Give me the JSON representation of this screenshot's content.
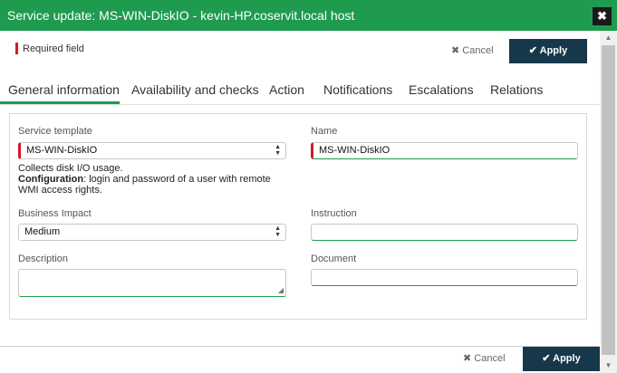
{
  "title": "Service update: MS-WIN-DiskIO - kevin-HP.coservit.local host",
  "close_icon": "✖",
  "required_field_label": "Required field",
  "cancel_label": "✖ Cancel",
  "apply_label": "✔ Apply",
  "tabs": [
    {
      "label": "General information",
      "active": true
    },
    {
      "label": "Availability and checks"
    },
    {
      "label": "Action"
    },
    {
      "label": "Notifications"
    },
    {
      "label": "Escalations"
    },
    {
      "label": "Relations"
    }
  ],
  "form": {
    "service_template": {
      "label": "Service template",
      "value": "MS-WIN-DiskIO"
    },
    "name": {
      "label": "Name",
      "value": "MS-WIN-DiskIO"
    },
    "help_line1": "Collects disk I/O usage.",
    "help_config_bold": "Configuration",
    "help_config_rest": ": login and password of a user with remote",
    "help_line3": "WMI access rights.",
    "business_impact": {
      "label": "Business Impact",
      "value": "Medium"
    },
    "instruction": {
      "label": "Instruction",
      "value": ""
    },
    "description": {
      "label": "Description",
      "value": ""
    },
    "document": {
      "label": "Document",
      "value": ""
    }
  },
  "colors": {
    "accent": "#1e9b4f",
    "apply_bg": "#17384b",
    "required": "#d21a2a"
  }
}
